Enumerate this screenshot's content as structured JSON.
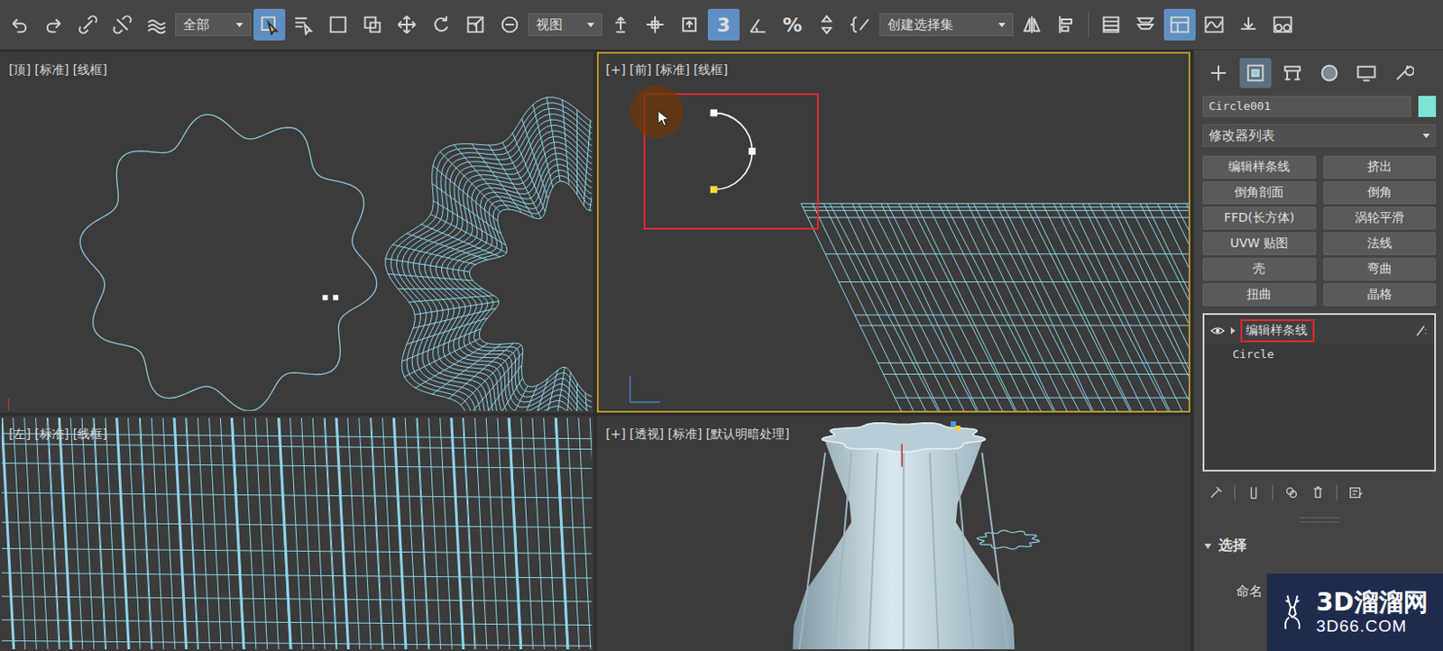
{
  "toolbar": {
    "selection_filter": "全部",
    "reference_coord": "视图",
    "selection_set": "创建选择集",
    "select_object_active": true,
    "snaps_toggle": {
      "label": "3",
      "active": true
    },
    "percent_snap": "%",
    "scene_explorer_active": true
  },
  "viewports": [
    {
      "label": "[顶] [标准] [线框]",
      "active": false,
      "annotation": false
    },
    {
      "label": "[+] [前] [标准] [线框]",
      "active": true,
      "annotation": true
    },
    {
      "label": "[左] [标准] [线框]",
      "active": false,
      "annotation": false
    },
    {
      "label": "[+] [透视] [标准] [默认明暗处理]",
      "active": false,
      "annotation": false
    }
  ],
  "command_panel": {
    "tabs": [
      {
        "selected": false
      },
      {
        "selected": true
      },
      {
        "selected": false
      },
      {
        "selected": false
      },
      {
        "selected": false
      },
      {
        "selected": false
      }
    ],
    "object_name": "Circle001",
    "object_color": "#7fe3d6",
    "modifier_list": "修改器列表",
    "modifier_buttons": [
      "编辑样条线",
      "挤出",
      "倒角剖面",
      "倒角",
      "FFD(长方体)",
      "涡轮平滑",
      "UVW 贴图",
      "法线",
      "壳",
      "弯曲",
      "扭曲",
      "晶格"
    ],
    "stack": [
      {
        "label": "编辑样条线",
        "selected": true,
        "expandable": true,
        "visible": true,
        "highlighted": true
      },
      {
        "label": "Circle",
        "selected": false,
        "expandable": false,
        "visible": false,
        "highlighted": false
      }
    ],
    "rollout": {
      "title": "选择",
      "expanded": true,
      "field": "命名"
    }
  },
  "watermark": {
    "name": "3D溜溜网",
    "url": "3D66.COM"
  }
}
